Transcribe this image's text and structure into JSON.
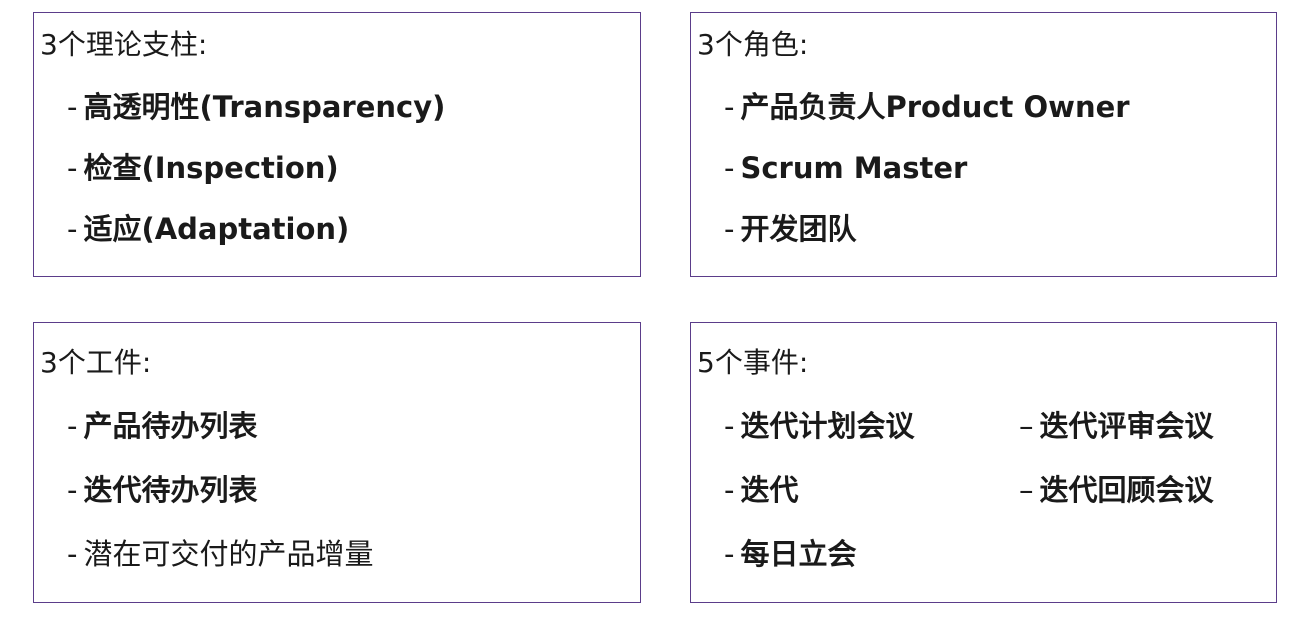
{
  "boxes": {
    "pillars": {
      "title": "3个理论支柱:",
      "items": [
        {
          "dash": "-",
          "label": "高透明性(Transparency)"
        },
        {
          "dash": "-",
          "label": "检查(Inspection)"
        },
        {
          "dash": "-",
          "label": "适应(Adaptation)"
        }
      ]
    },
    "roles": {
      "title": "3个角色:",
      "items": [
        {
          "dash": "-",
          "label": "产品负责人Product Owner"
        },
        {
          "dash": "-",
          "label": "Scrum Master"
        },
        {
          "dash": "-",
          "label": "开发团队"
        }
      ]
    },
    "artifacts": {
      "title": "3个工件:",
      "items": [
        {
          "dash": "-",
          "label": "产品待办列表"
        },
        {
          "dash": "-",
          "label": "迭代待办列表"
        },
        {
          "dash": "-",
          "label": "潜在可交付的产品增量"
        }
      ]
    },
    "events": {
      "title": "5个事件:",
      "items_left": [
        {
          "dash": "-",
          "label": "迭代计划会议"
        },
        {
          "dash": "-",
          "label": "迭代"
        },
        {
          "dash": "-",
          "label": "每日立会"
        }
      ],
      "items_right": [
        {
          "dash": "–",
          "label": "迭代评审会议"
        },
        {
          "dash": "–",
          "label": "迭代回顾会议"
        }
      ]
    }
  }
}
